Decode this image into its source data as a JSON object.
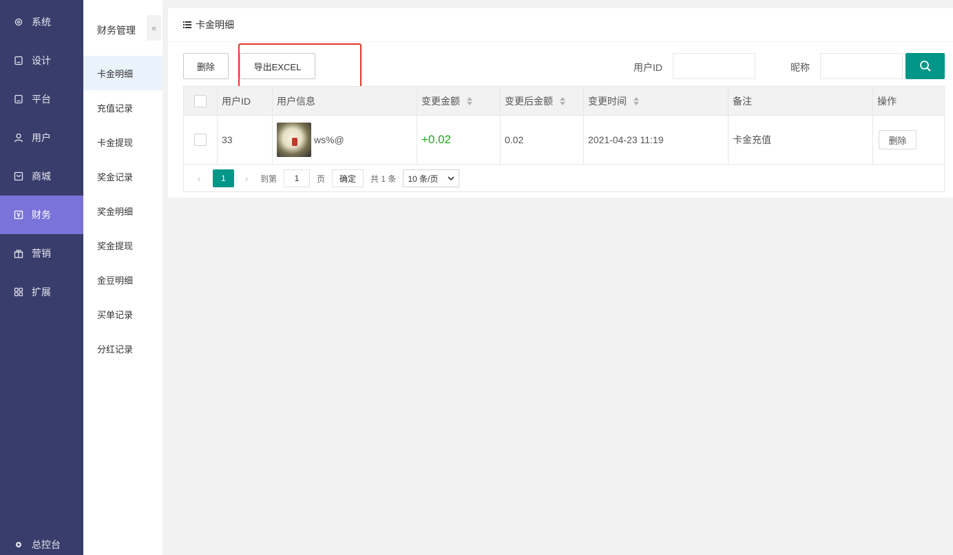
{
  "nav": {
    "items": [
      {
        "label": "系统",
        "icon": "gear-icon"
      },
      {
        "label": "设计",
        "icon": "design-icon"
      },
      {
        "label": "平台",
        "icon": "platform-icon"
      },
      {
        "label": "用户",
        "icon": "user-icon"
      },
      {
        "label": "商城",
        "icon": "shop-icon"
      },
      {
        "label": "财务",
        "icon": "finance-icon",
        "active": true
      },
      {
        "label": "营销",
        "icon": "gift-icon"
      },
      {
        "label": "扩展",
        "icon": "grid-icon"
      }
    ],
    "bottom_label": "总控台"
  },
  "subnav": {
    "title": "财务管理",
    "collapse_icon": "«",
    "items": [
      {
        "label": "卡金明细",
        "active": true
      },
      {
        "label": "充值记录"
      },
      {
        "label": "卡金提现"
      },
      {
        "label": "奖金记录"
      },
      {
        "label": "奖金明细"
      },
      {
        "label": "奖金提现"
      },
      {
        "label": "金豆明细"
      },
      {
        "label": "买单记录"
      },
      {
        "label": "分红记录"
      }
    ]
  },
  "panel": {
    "title": "卡金明细"
  },
  "toolbar": {
    "delete_label": "删除",
    "export_label": "导出EXCEL",
    "userid_label": "用户ID",
    "nickname_label": "昵称",
    "userid_value": "",
    "nickname_value": ""
  },
  "table": {
    "headers": [
      "用户ID",
      "用户信息",
      "变更金额",
      "变更后金额",
      "变更时间",
      "备注",
      "操作"
    ],
    "rows": [
      {
        "user_id": "33",
        "user_name": "ws%@",
        "change_amount": "+0.02",
        "after_amount": "0.02",
        "change_time": "2021-04-23 11:19",
        "remark": "卡金充值",
        "action_label": "删除"
      }
    ]
  },
  "pager": {
    "current_page": "1",
    "goto_label": "到第",
    "goto_value": "1",
    "page_unit": "页",
    "confirm_label": "确定",
    "total_label": "共 1 条",
    "page_size": "10 条/页",
    "prev_icon": "‹",
    "next_icon": "›"
  },
  "colors": {
    "nav_bg": "#393d6b",
    "nav_active": "#7a73d9",
    "accent": "#009688",
    "amount_positive": "#22a51a",
    "highlight_box": "#e0362b"
  }
}
